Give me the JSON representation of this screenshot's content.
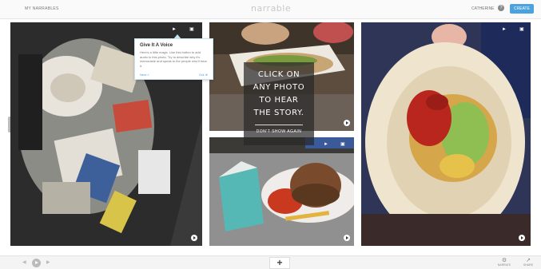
{
  "topbar": {
    "nav_label": "MY NARRABLES",
    "logo_text": "narrable",
    "user_name": "CATHERINE",
    "help_glyph": "?",
    "create_label": "CREATE",
    "accent_color": "#4aa3df"
  },
  "tooltip": {
    "title": "Give It A Voice",
    "body": "Here's a little magic. Use this button to add audio to this photo. Try to describe why it's memorable and speak to the people who'll hear it.",
    "next_label": "Next »",
    "done_label": "Got It!"
  },
  "overlay": {
    "line1": "CLICK ON",
    "line2": "ANY PHOTO",
    "line3": "TO HEAR",
    "line4": "THE STORY.",
    "dismiss_label": "DON'T SHOW AGAIN"
  },
  "tiles": [
    {
      "id": "trash-bin",
      "icon_audio": "speaker-icon",
      "icon_edit": "image-icon"
    },
    {
      "id": "hot-dog",
      "icon_audio": "speaker-icon",
      "icon_edit": "image-icon"
    },
    {
      "id": "burger-tray",
      "icon_audio": "speaker-icon",
      "icon_edit": "image-icon"
    },
    {
      "id": "burrito",
      "icon_audio": "speaker-icon",
      "icon_edit": "image-icon"
    }
  ],
  "bottombar": {
    "add_label": "+",
    "narrate_label": "NARRATE",
    "share_label": "SHARE"
  }
}
